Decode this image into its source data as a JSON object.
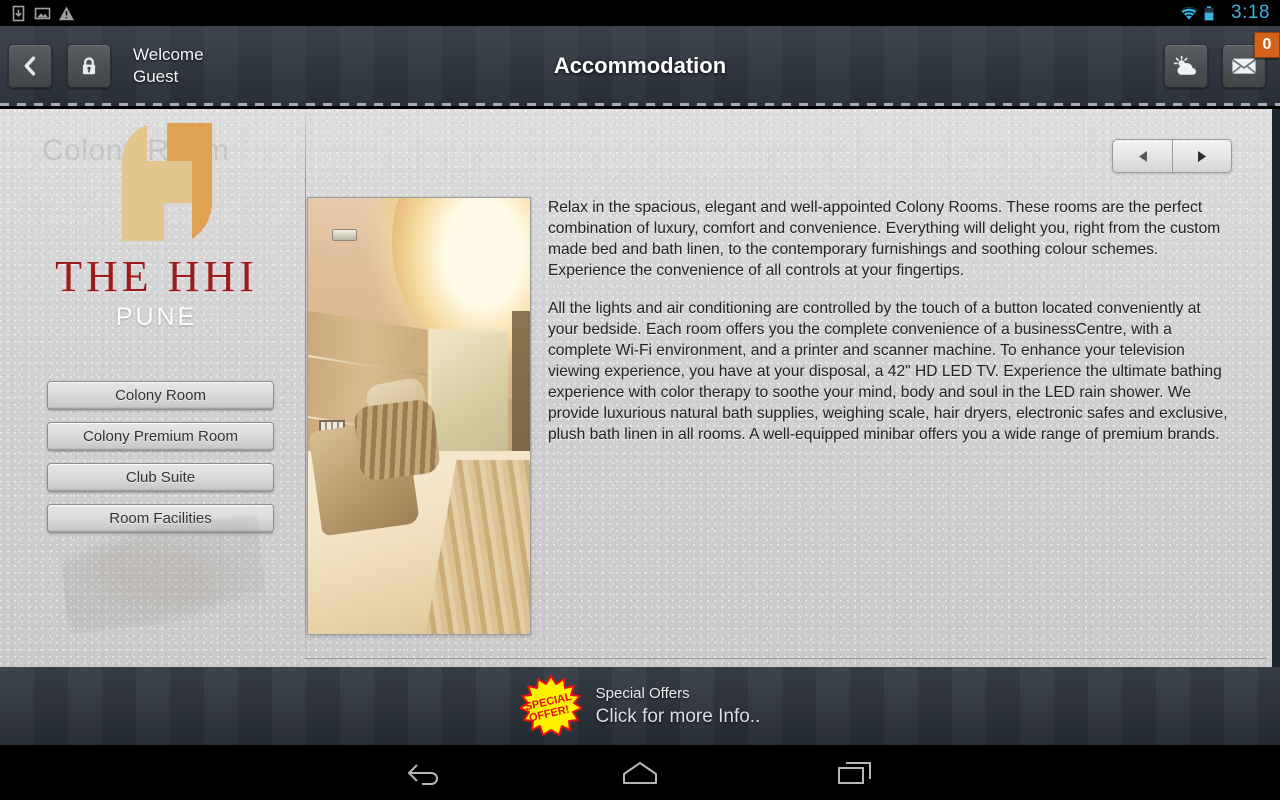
{
  "status_bar": {
    "icons": [
      "download-icon",
      "image-icon",
      "warning-icon"
    ],
    "wifi_icon": "wifi-icon",
    "battery_icon": "battery-icon",
    "clock": "3:18",
    "accent_color": "#3ab3e0"
  },
  "header": {
    "back_icon": "back-chevron-icon",
    "lock_icon": "lock-icon",
    "welcome_line1": "Welcome",
    "welcome_line2": "Guest",
    "title": "Accommodation",
    "weather_icon": "weather-sun-cloud-icon",
    "mail_icon": "mail-icon",
    "mail_badge": "0",
    "badge_color": "#d2621a"
  },
  "sidebar": {
    "watermark": "Colony Room",
    "logo_icon": "hhi-monogram-logo",
    "brand": "THE HHI",
    "brand_sub": "PUNE",
    "brand_color": "#9e1b1b",
    "logo_gold_light": "#e2c68e",
    "logo_gold_dark": "#e0a352",
    "items": [
      {
        "label": "Colony Room"
      },
      {
        "label": "Colony Premium Room"
      },
      {
        "label": "Club Suite"
      },
      {
        "label": "Room Facilities"
      }
    ]
  },
  "content": {
    "prev_icon": "triangle-left-icon",
    "next_icon": "triangle-right-icon",
    "photo_alt": "colony-room-photo",
    "paragraphs": [
      "Relax in the spacious, elegant and well-appointed Colony Rooms. These rooms are the perfect combination of luxury, comfort and convenience. Everything will delight you, right from the custom made bed and bath linen, to the contemporary furnishings and soothing colour schemes. Experience the convenience of all controls at your fingertips.",
      "All the lights and air conditioning are controlled by the touch of a button located conveniently at your bedside. Each room offers you the complete convenience of a businessCentre, with a complete Wi-Fi environment, and a printer and scanner machine. To enhance your television viewing experience, you have at your disposal, a 42\" HD LED TV. Experience the ultimate bathing experience with color therapy to soothe your mind, body and soul in the LED rain shower. We provide luxurious natural bath supplies, weighing scale, hair dryers, electronic safes and exclusive, plush bath linen in all rooms. A well-equipped minibar offers you a wide range of premium brands."
    ]
  },
  "offers": {
    "badge_icon": "special-offer-burst-icon",
    "badge_line1": "SPECIAL",
    "badge_line2": "OFFER!",
    "title": "Special Offers",
    "subtitle": "Click for more Info.."
  },
  "navbar": {
    "back_icon": "android-back-icon",
    "home_icon": "android-home-icon",
    "recents_icon": "android-recents-icon"
  }
}
